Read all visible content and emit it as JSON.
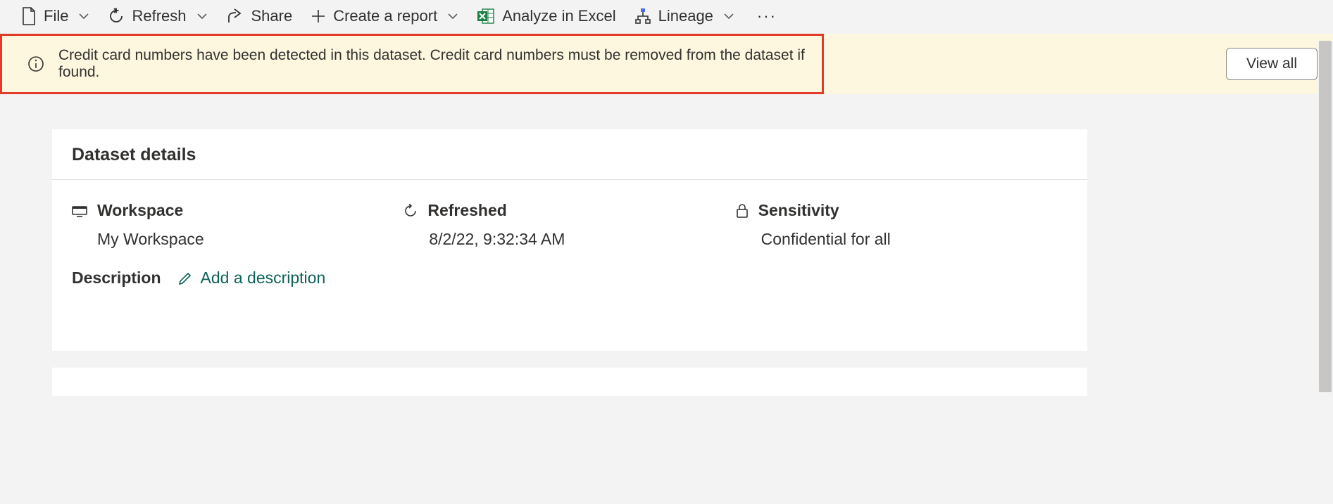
{
  "toolbar": {
    "file": "File",
    "refresh": "Refresh",
    "share": "Share",
    "create_report": "Create a report",
    "analyze_excel": "Analyze in Excel",
    "lineage": "Lineage"
  },
  "banner": {
    "message": "Credit card numbers have been detected in this dataset. Credit card numbers must be removed from the dataset if found.",
    "view_all": "View all"
  },
  "card": {
    "title": "Dataset details",
    "workspace_label": "Workspace",
    "workspace_value": "My Workspace",
    "refreshed_label": "Refreshed",
    "refreshed_value": "8/2/22, 9:32:34 AM",
    "sensitivity_label": "Sensitivity",
    "sensitivity_value": "Confidential for all",
    "description_label": "Description",
    "add_description": "Add a description"
  }
}
